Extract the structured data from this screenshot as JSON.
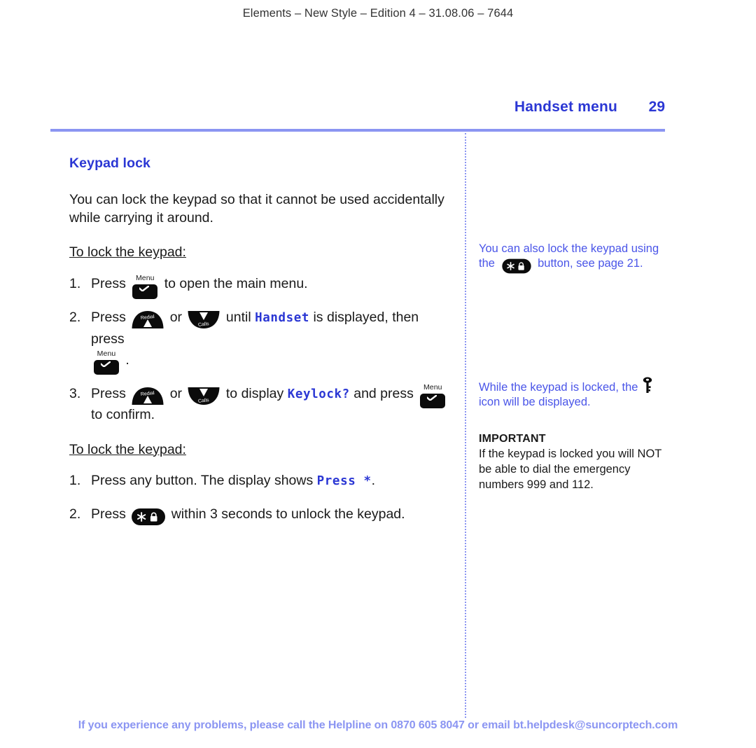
{
  "running_head": "Elements – New Style – Edition 4 – 31.08.06 – 7644",
  "header": {
    "chapter_title": "Handset menu",
    "page_number": "29",
    "rule_color": "#8b95f2"
  },
  "main": {
    "section_heading": "Keypad lock",
    "intro_paragraph": "You can lock the keypad so that it cannot be used accidentally while carrying it around.",
    "lock_subheading": "To lock the keypad:",
    "lock_steps": [
      {
        "num": "1.",
        "before": "Press",
        "icon": "menu-check-key",
        "after": "to open the main menu."
      },
      {
        "num": "2.",
        "before": "Press",
        "icon": "redial-up-key",
        "mid1": "or",
        "icon2": "calls-down-key",
        "mid2": "until",
        "lcd": "Handset",
        "mid3": "is displayed, then press",
        "icon3": "menu-check-key",
        "after": "."
      },
      {
        "num": "3.",
        "before": "Press",
        "icon": "redial-up-key",
        "mid1": "or",
        "icon2": "calls-down-key",
        "mid2": "to display",
        "lcd": "Keylock?",
        "mid3": "and press",
        "icon3": "menu-check-key",
        "after": "to confirm."
      }
    ],
    "unlock_subheading": "To lock the keypad:",
    "unlock_steps": [
      {
        "num": "1.",
        "before": "Press any button. The display shows",
        "lcd": "Press *",
        "after": "."
      },
      {
        "num": "2.",
        "before": "Press",
        "icon": "star-lock-key",
        "after": "within 3 seconds to unlock the keypad."
      }
    ]
  },
  "sidebar": {
    "note_1": {
      "part_1": "You can also lock the keypad using the",
      "icon": "star-lock-key",
      "part_2": "button, see page 21."
    },
    "note_2": {
      "part_1": "While the keypad is locked, the",
      "icon": "key-icon",
      "part_2": "icon will be displayed."
    },
    "important": {
      "title": "IMPORTANT",
      "text": "If the keypad is locked you will NOT be able to dial the emergency numbers 999 and 112."
    }
  },
  "footer": "If you experience any problems, please call the Helpline on 0870 605 8047 or email bt.helpdesk@suncorptech.com",
  "icon_labels": {
    "menu": "Menu",
    "redial": "Redial",
    "calls": "Calls"
  },
  "colors": {
    "brand_blue": "#2b37d4",
    "light_blue": "#8b95f2",
    "side_text": "#4a55e8",
    "key_black": "#0b0b0b"
  }
}
